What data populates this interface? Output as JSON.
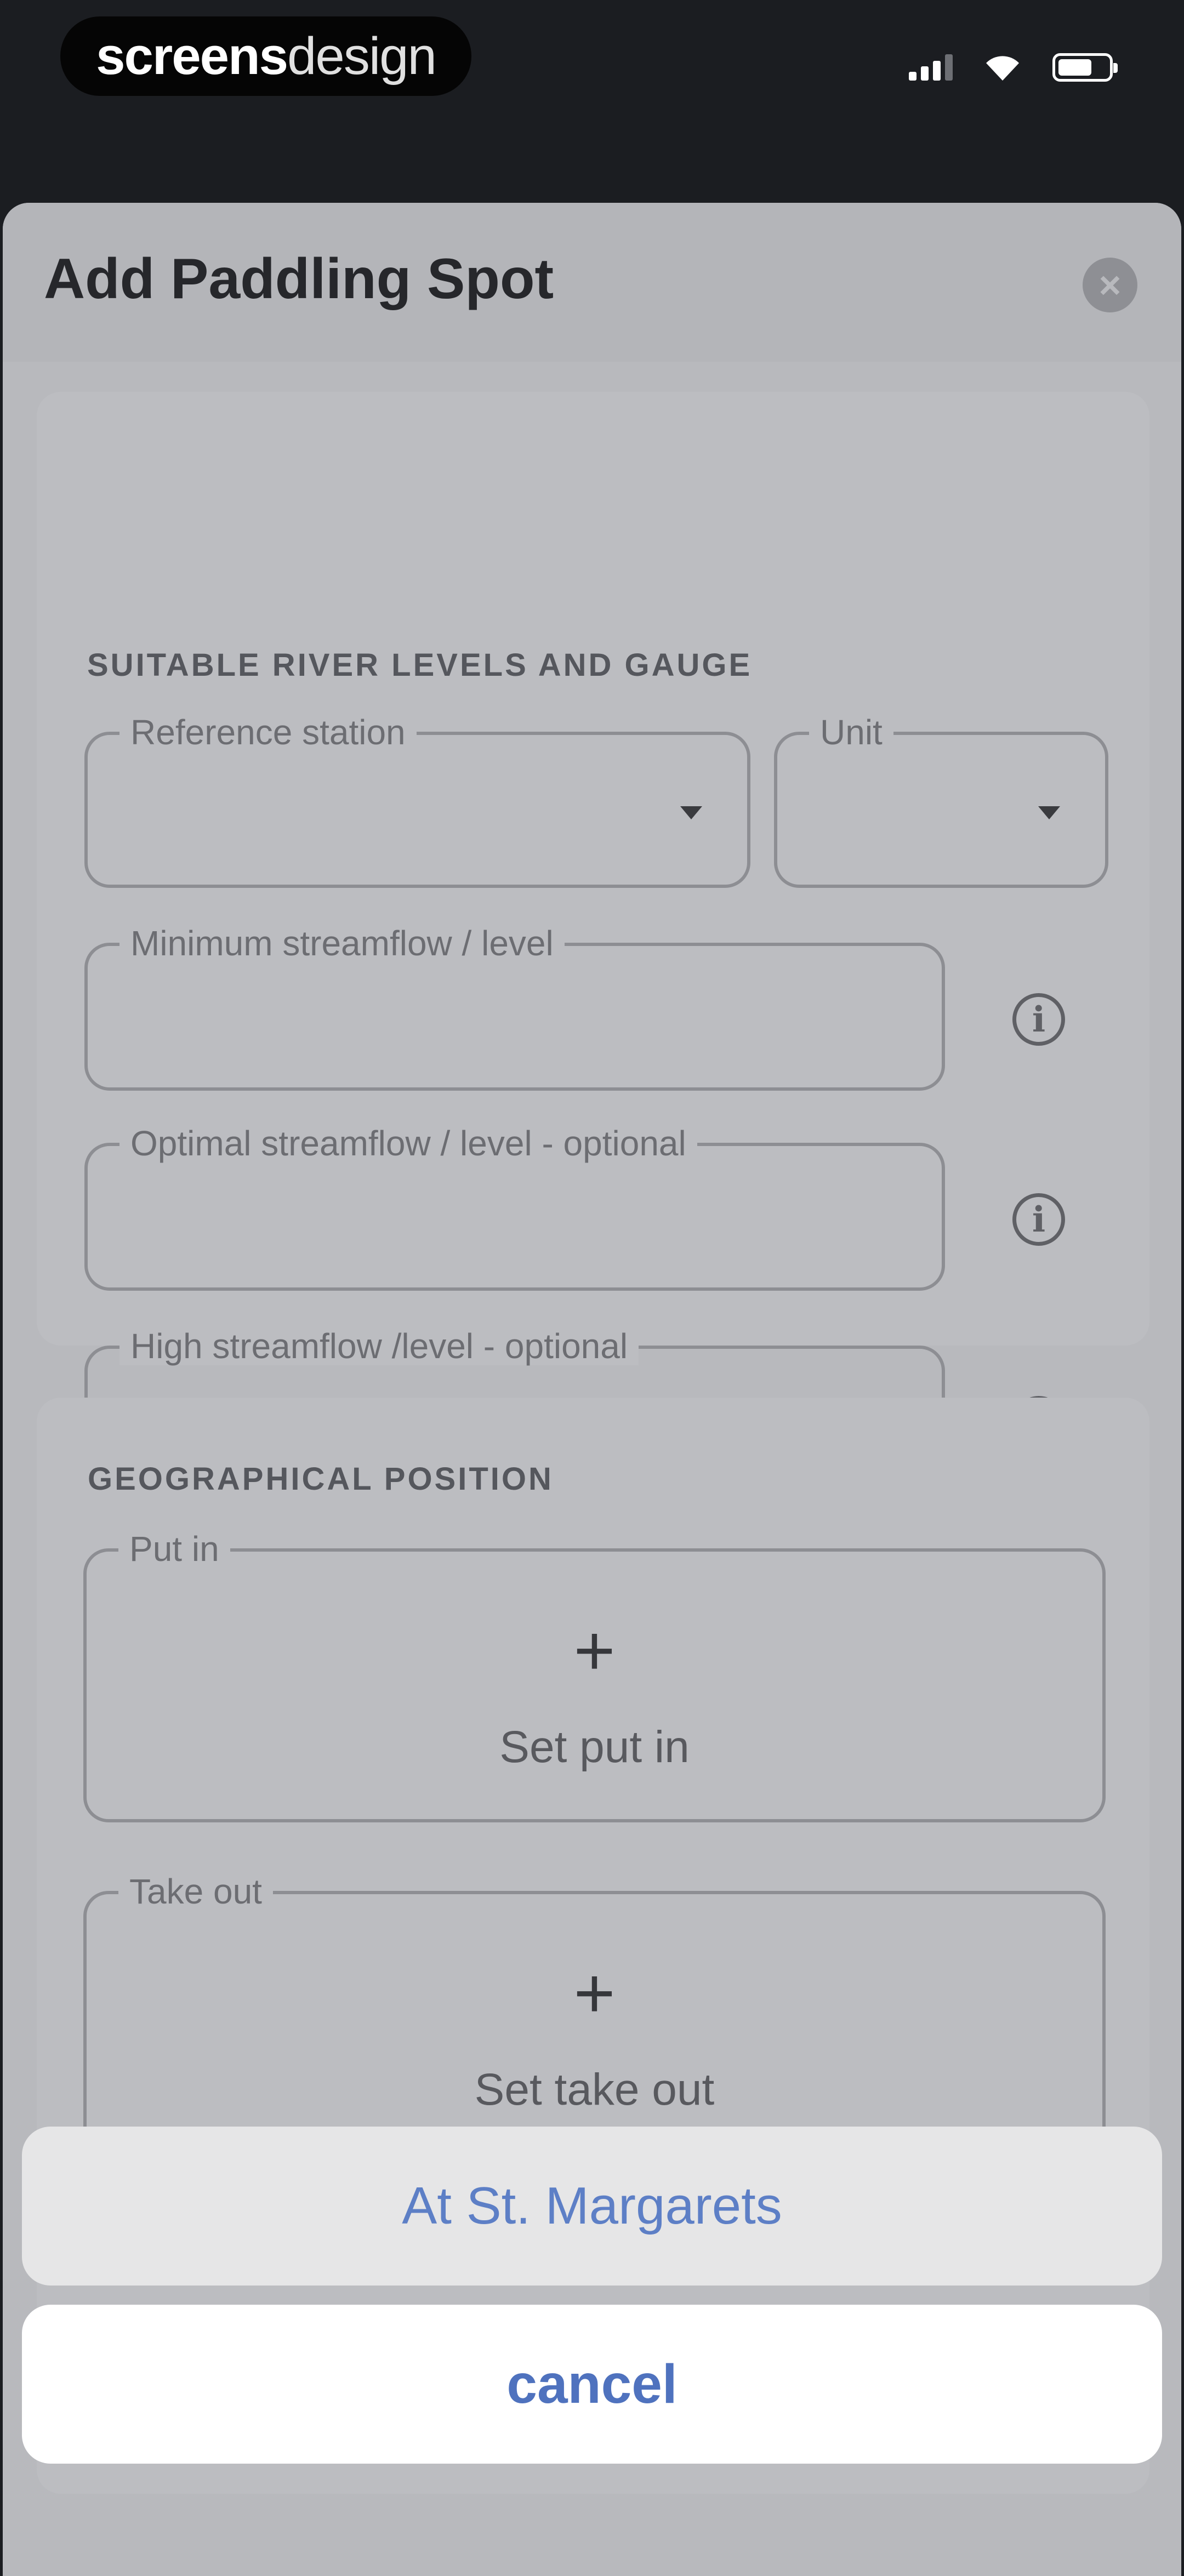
{
  "status_bar": {
    "brand": {
      "bold": "screens",
      "light": "design"
    },
    "icons": [
      "signal-icon",
      "wifi-icon",
      "battery-icon"
    ]
  },
  "sheet": {
    "title": "Add Paddling Spot",
    "close_icon": "close-icon"
  },
  "river_levels": {
    "title": "SUITABLE RIVER LEVELS AND GAUGE",
    "reference_station": {
      "label": "Reference station",
      "value": ""
    },
    "unit": {
      "label": "Unit",
      "value": ""
    },
    "minimum": {
      "label": "Minimum streamflow / level",
      "value": ""
    },
    "optimal": {
      "label": "Optimal streamflow / level - optional",
      "value": ""
    },
    "high": {
      "label": "High streamflow /level - optional",
      "value": ""
    },
    "info_icon": "info-icon"
  },
  "geo_position": {
    "title": "GEOGRAPHICAL POSITION",
    "put_in": {
      "label": "Put in",
      "action": "Set put in",
      "icon": "+"
    },
    "take_out": {
      "label": "Take out",
      "action": "Set take out",
      "icon": "+"
    }
  },
  "action_sheet": {
    "option": "At St. Margarets",
    "cancel": "cancel"
  },
  "colors": {
    "accent": "#4f72be",
    "sheet_bg": "#b8b9bd",
    "status_bar_bg": "#1b1d21"
  }
}
